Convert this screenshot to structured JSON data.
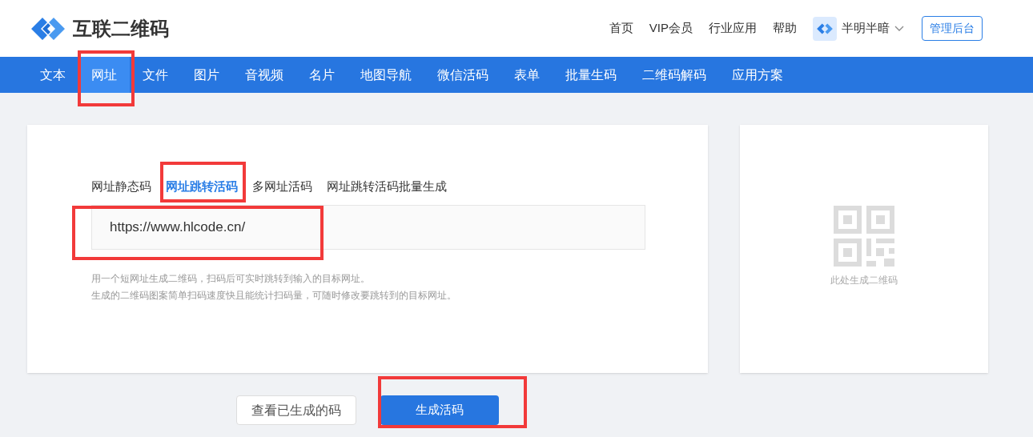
{
  "header": {
    "logo_text": "互联二维码",
    "links": [
      "首页",
      "VIP会员",
      "行业应用",
      "帮助"
    ],
    "user": {
      "name": "半明半暗"
    },
    "admin_button": "管理后台"
  },
  "nav": [
    {
      "label": "文本",
      "selected": false,
      "highlighted": false
    },
    {
      "label": "网址",
      "selected": true,
      "highlighted": true
    },
    {
      "label": "文件",
      "selected": false,
      "highlighted": false
    },
    {
      "label": "图片",
      "selected": false,
      "highlighted": false
    },
    {
      "label": "音视频",
      "selected": false,
      "highlighted": false
    },
    {
      "label": "名片",
      "selected": false,
      "highlighted": false
    },
    {
      "label": "地图导航",
      "selected": false,
      "highlighted": false
    },
    {
      "label": "微信活码",
      "selected": false,
      "highlighted": false
    },
    {
      "label": "表单",
      "selected": false,
      "highlighted": false
    },
    {
      "label": "批量生码",
      "selected": false,
      "highlighted": false
    },
    {
      "label": "二维码解码",
      "selected": false,
      "highlighted": false
    },
    {
      "label": "应用方案",
      "selected": false,
      "highlighted": false
    }
  ],
  "tabs": [
    {
      "label": "网址静态码",
      "selected": false,
      "highlighted": false
    },
    {
      "label": "网址跳转活码",
      "selected": true,
      "highlighted": true
    },
    {
      "label": "多网址活码",
      "selected": false,
      "highlighted": false
    },
    {
      "label": "网址跳转活码批量生成",
      "selected": false,
      "highlighted": false
    }
  ],
  "url_input": {
    "value": "https://www.hlcode.cn/",
    "highlighted": true
  },
  "hints": [
    "用一个短网址生成二维码，扫码后可实时跳转到输入的目标网址。",
    "生成的二维码图案简单扫码速度快且能统计扫码量，可随时修改要跳转到的目标网址。"
  ],
  "preview": {
    "caption": "此处生成二维码"
  },
  "buttons": [
    {
      "label": "查看已生成的码",
      "kind": "secondary",
      "highlighted": false
    },
    {
      "label": "生成活码",
      "kind": "primary",
      "highlighted": true
    }
  ]
}
